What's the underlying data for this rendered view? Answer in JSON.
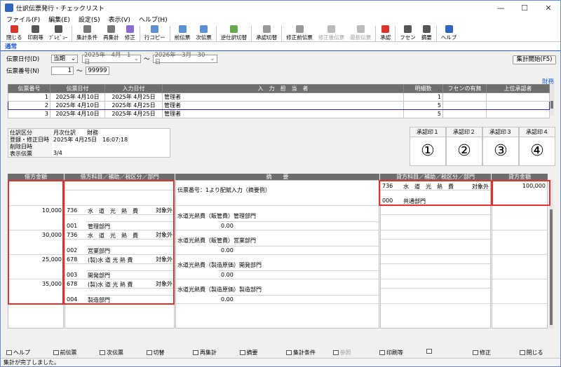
{
  "window": {
    "title": "仕訳伝票発行・チェックリスト",
    "min": "—",
    "max": "☐",
    "close": "✕"
  },
  "menu": [
    "ファイル(F)",
    "編集(E)",
    "設定(S)",
    "表示(V)",
    "ヘルプ(H)"
  ],
  "toolbar": [
    {
      "label": "閉じる",
      "icon": "close-icon",
      "color": "#d9342b",
      "enabled": true
    },
    {
      "label": "印刷等",
      "icon": "printer-icon",
      "color": "#555555",
      "enabled": true
    },
    {
      "label": "ﾌﾟﾚﾋﾞｭｰ",
      "icon": "preview-icon",
      "color": "#555555",
      "enabled": true
    },
    {
      "label": "集計条件",
      "icon": "filter-icon",
      "color": "#777777",
      "enabled": true
    },
    {
      "label": "再集計",
      "icon": "refresh-icon",
      "color": "#777777",
      "enabled": true
    },
    {
      "label": "修正",
      "icon": "edit-icon",
      "color": "#8a6bd1",
      "enabled": true
    },
    {
      "label": "行コピー",
      "icon": "copy-row-icon",
      "color": "#5b8fd6",
      "enabled": true
    },
    {
      "label": "前伝票",
      "icon": "prev-slip-icon",
      "color": "#5b8fd6",
      "enabled": true
    },
    {
      "label": "次伝票",
      "icon": "next-slip-icon",
      "color": "#5b8fd6",
      "enabled": true
    },
    {
      "label": "逆仕訳切替",
      "icon": "reverse-icon",
      "color": "#6aa84f",
      "enabled": true
    },
    {
      "label": "承認切替",
      "icon": "approve-toggle-icon",
      "color": "#999999",
      "enabled": true
    },
    {
      "label": "修正前伝票",
      "icon": "before-edit-icon",
      "color": "#999999",
      "enabled": true
    },
    {
      "label": "修正後伝票",
      "icon": "after-edit-icon",
      "color": "#bbbbbb",
      "enabled": false
    },
    {
      "label": "最新伝票",
      "icon": "latest-icon",
      "color": "#bbbbbb",
      "enabled": false
    },
    {
      "label": "承認",
      "icon": "approve-icon",
      "color": "#d9342b",
      "enabled": true
    },
    {
      "label": "フセン",
      "icon": "sticky-note-icon",
      "color": "#555555",
      "enabled": true
    },
    {
      "label": "摘要",
      "icon": "memo-icon",
      "color": "#555555",
      "enabled": true
    },
    {
      "label": "ヘルプ",
      "icon": "help-icon",
      "color": "#2f66c1",
      "enabled": true
    }
  ],
  "tab": "通常",
  "filters": {
    "date_label": "伝票日付(D)",
    "period": "当期",
    "from_date": "2025年　4月　1日",
    "tilde": "～",
    "to_date": "2026年　3月　30日",
    "number_label": "伝票番号(N)",
    "from_no": "1",
    "to_no": "99999",
    "run_button": "集計開始(F5)",
    "zaimu_link": "財務"
  },
  "slip_list": {
    "headers": [
      "伝票番号",
      "伝票日付",
      "入力日付",
      "入　力　担　当　者",
      "明細数",
      "フセンの有無",
      "上位承認者"
    ],
    "rows": [
      {
        "no": "1",
        "date": "2025年 4月10日",
        "input": "2025年 4月25日",
        "user": "管理者",
        "count": "1",
        "sticky": "",
        "approver": ""
      },
      {
        "no": "2",
        "date": "2025年 4月10日",
        "input": "2025年 4月25日",
        "user": "管理者",
        "count": "5",
        "sticky": "",
        "approver": ""
      },
      {
        "no": "3",
        "date": "2025年 4月10日",
        "input": "2025年 4月25日",
        "user": "管理者",
        "count": "5",
        "sticky": "",
        "approver": ""
      }
    ]
  },
  "slip_info": {
    "rows": [
      {
        "label": "仕訳区分",
        "value": "月次仕訳　　財務"
      },
      {
        "label": "登録・修正日時",
        "value": "2025年 4月25日　16:07:18"
      },
      {
        "label": "削除日時",
        "value": ""
      },
      {
        "label": "表示伝票",
        "value": "3/4"
      }
    ]
  },
  "stamps": [
    {
      "label": "承認印１",
      "mark": "①"
    },
    {
      "label": "承認印２",
      "mark": "②"
    },
    {
      "label": "承認印３",
      "mark": "③"
    },
    {
      "label": "承認印４",
      "mark": "④"
    }
  ],
  "journal": {
    "headers": {
      "debit_amount": "借方金額",
      "debit_account": "借方科目／補助／税区分／部門",
      "memo": "摘　　要",
      "credit_account": "貸方科目／補助／税区分／部門",
      "credit_amount": "貸方金額"
    },
    "header_memo": "伝票番号：1より配賦入力（摘要例）",
    "credit_top": {
      "code": "736",
      "account": "水　道　光　熱　費",
      "tax": "対象外",
      "dept_code": "000",
      "dept": "共通部門",
      "amount": "100,000"
    },
    "lines": [
      {
        "amount": "10,000",
        "code": "736",
        "account": "水　道　光　熱　費",
        "tax": "対象外",
        "dept_code": "001",
        "dept": "管理部門",
        "memo": "水道光熱費（販管費）管理部門",
        "sub": "0.00"
      },
      {
        "amount": "30,000",
        "code": "736",
        "account": "水　道　光　熱　費",
        "tax": "対象外",
        "dept_code": "002",
        "dept": "営業部門",
        "memo": "水道光熱費（販管費）営業部門",
        "sub": "0.00"
      },
      {
        "amount": "25,000",
        "code": "678",
        "account": "(製)水 道 光 熱 費",
        "tax": "対象外",
        "dept_code": "003",
        "dept": "開発部門",
        "memo": "水道光熱費（製造原価）開発部門",
        "sub": "0.00"
      },
      {
        "amount": "35,000",
        "code": "678",
        "account": "(製)水 道 光 熱 費",
        "tax": "対象外",
        "dept_code": "004",
        "dept": "製造部門",
        "memo": "水道光熱費（製造原価）製造部門",
        "sub": "0.00"
      }
    ]
  },
  "fkeys": [
    {
      "key": "F1",
      "label": "ヘルプ",
      "enabled": true
    },
    {
      "key": "F2",
      "label": "前伝票",
      "enabled": true
    },
    {
      "key": "F3",
      "label": "次伝票",
      "enabled": true
    },
    {
      "key": "F4",
      "label": "切替",
      "enabled": true
    },
    {
      "key": "F5",
      "label": "再集計",
      "enabled": true
    },
    {
      "key": "F6",
      "label": "摘要",
      "enabled": true
    },
    {
      "key": "F7",
      "label": "集計条件",
      "enabled": true
    },
    {
      "key": "F8",
      "label": "参照",
      "enabled": false
    },
    {
      "key": "F9",
      "label": "印刷等",
      "enabled": true
    },
    {
      "key": "F10",
      "label": "",
      "enabled": false
    },
    {
      "key": "F11",
      "label": "修正",
      "enabled": true
    },
    {
      "key": "F12",
      "label": "閉じる",
      "enabled": true
    }
  ],
  "status": "集計が完了しました。"
}
